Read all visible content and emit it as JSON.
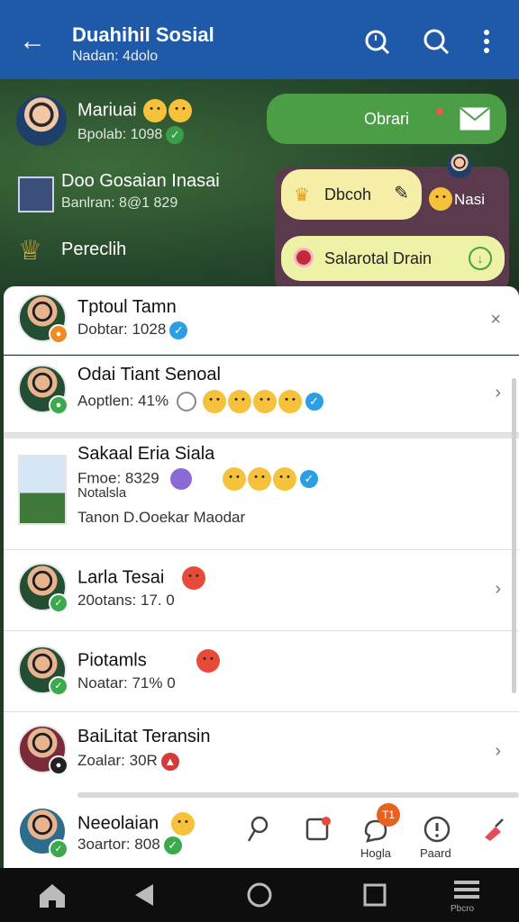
{
  "header": {
    "title": "Duahihil Sosial",
    "subtitle": "Nadan: 4dolo"
  },
  "top_list": [
    {
      "name": "Mariuai",
      "sub": "Bpolab: 1098"
    },
    {
      "name": "Doo Gosaian Inasai",
      "sub": "Banlran: 8@1 829"
    },
    {
      "name": "Pereclih",
      "sub": ""
    }
  ],
  "bubbles": {
    "green": "Obrari",
    "yellow1": "Dbcoh",
    "side_label": "Nasi",
    "yellow2": "Salarotal Drain"
  },
  "cards": [
    {
      "name": "Tptoul Tamn",
      "sub": "Dobtar: 1028"
    },
    {
      "name": "Odai Tiant Senoal",
      "sub": "Aoptlen: 41%"
    },
    {
      "name": "Sakaal Eria Siala",
      "sub": "Fmoe: 8329",
      "sub2": "Notalsla",
      "sub3": "Tanon D.Ooekar Maodar"
    },
    {
      "name": "Larla Tesai",
      "sub": "20otans: 17. 0"
    },
    {
      "name": "Piotamls",
      "sub": "Noatar: 71% 0"
    },
    {
      "name": "BaiLitat Teransin",
      "sub": "Zoalar: 30R"
    }
  ],
  "bottom": {
    "name": "Neeolaian",
    "sub": "3oartor: 808",
    "notif_badge": "T1",
    "label_1": "Hogla",
    "label_2": "Paard"
  },
  "nav_label": "Pbcro",
  "colors": {
    "header": "#1e5aa8",
    "accent_green": "#4b9e46",
    "check_blue": "#2a9fe3"
  }
}
